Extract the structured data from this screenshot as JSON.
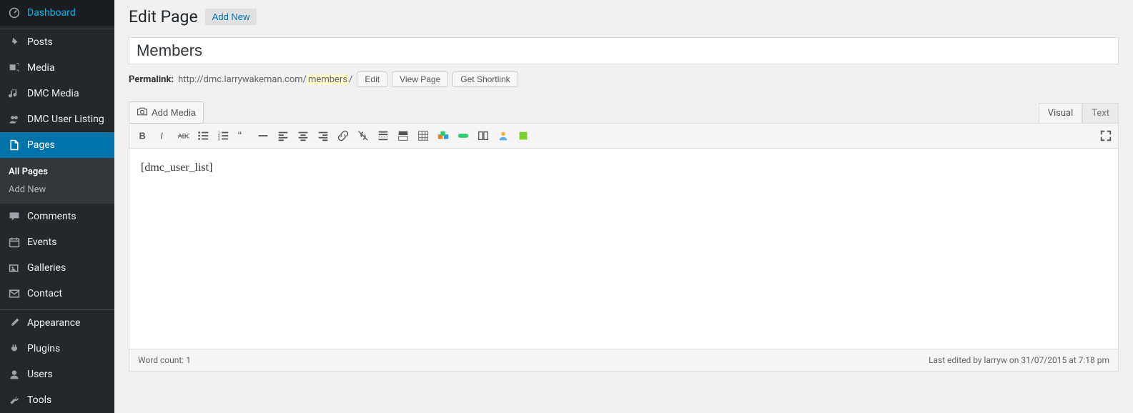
{
  "sidebar": {
    "items": [
      {
        "label": "Dashboard"
      },
      {
        "label": "Posts"
      },
      {
        "label": "Media"
      },
      {
        "label": "DMC Media"
      },
      {
        "label": "DMC User Listing"
      },
      {
        "label": "Pages"
      },
      {
        "label": "Comments"
      },
      {
        "label": "Events"
      },
      {
        "label": "Galleries"
      },
      {
        "label": "Contact"
      },
      {
        "label": "Appearance"
      },
      {
        "label": "Plugins"
      },
      {
        "label": "Users"
      },
      {
        "label": "Tools"
      }
    ],
    "submenu": {
      "all": "All Pages",
      "add": "Add New"
    }
  },
  "header": {
    "title": "Edit Page",
    "add_new": "Add New"
  },
  "post": {
    "title": "Members",
    "permalink_label": "Permalink:",
    "permalink_base": "http://dmc.larrywakeman.com/",
    "permalink_slug": "members",
    "permalink_trail": "/",
    "edit_btn": "Edit",
    "view_btn": "View Page",
    "shortlink_btn": "Get Shortlink"
  },
  "editor": {
    "add_media": "Add Media",
    "tab_visual": "Visual",
    "tab_text": "Text",
    "content": "[dmc_user_list]"
  },
  "status": {
    "word_count_label": "Word count: ",
    "word_count": "1",
    "last_edited": "Last edited by larryw on 31/07/2015 at 7:18 pm"
  }
}
